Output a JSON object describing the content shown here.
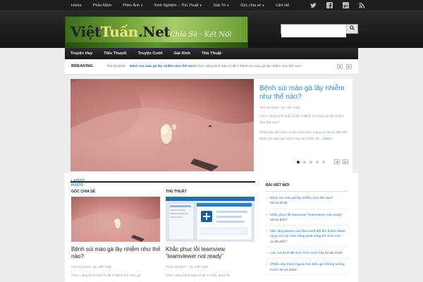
{
  "topnav": {
    "items": [
      "Home",
      "Phần Mềm",
      "Phim Ảnh",
      "Kinh Nghiệm – Thủ Thuật",
      "Giải Trí",
      "Góc chia sẻ",
      "Liên Hệ"
    ]
  },
  "header": {
    "logo_part1": "Việt",
    "logo_part2": "Tuấn",
    "logo_part3": ".Net",
    "tagline": "Chia Sẻ · Kết Nối",
    "search_placeholder": ""
  },
  "catnav": {
    "items": [
      "Truyện Hay",
      "Tiểu Thuyết",
      "Truyện Cười",
      "Gái Xinh",
      "Thủ Thuật"
    ]
  },
  "breaking": {
    "label": "BREAKING",
    "date": "Th4 03,2018",
    "link": "Bệnh sùi mào gà lây nhiễm như thế nào?",
    "excerpt": "Chức năng bình luận bị tắt ở Bệnh sùi mào gà lây nhiễm như thế nào?",
    "prev": "◂",
    "next": "▸"
  },
  "slider": {
    "title": "Bệnh sùi mào gà lây nhiễm như thế nào?",
    "meta": "Th4 03,2018 · by Viết Tuấn",
    "comments": "Chức năng bình luận bị tắt ở Bệnh sùi mào gà lây nhiễm như thế nào?",
    "excerpt": "Chào bác sĩ! Cháu có tìm hiểu trên mạng và được biết đến bệnh sùi mào gà một trong các bệnh xã...",
    "more": "more »",
    "prev": "◂",
    "next": "▸"
  },
  "latest": {
    "label1": "LATEST",
    "label2": "POSTS"
  },
  "posts": [
    {
      "category": "GÓC CHIA SẺ",
      "title": "Bệnh sùi mào gà lây nhiễm như thế nào?",
      "meta": "Th4 03,2018 · by Viết Tuấn",
      "excerpt": "Chức năng bình luận bị tắt ở Bệnh sùi mào gà"
    },
    {
      "category": "THỦ THUẬT",
      "title": "Khắc phục lỗi teamview “teamviewer not ready”",
      "meta": "Th12 25,2017 · by Viết Tuấn",
      "excerpt": "Chức năng bình luận bị tắt ở Khắc phục lỗi"
    }
  ],
  "sidebar": {
    "title": "BÀI VIẾT MỚI",
    "items": [
      {
        "text": "Bệnh sùi mào gà lây nhiễm như thế nào?",
        "date": "03.04.2018"
      },
      {
        "text": "Khắc phục lỗi teamview “teamviewer not ready”",
        "date": "25.12.2017"
      },
      {
        "text": "Nền tảng Beam của Microsoft đổi tên thành Mixer cùng với các tính năng phát sóng trò chơi mới",
        "date": "11.06.2017"
      },
      {
        "text": "Các mã lệnh để chơi GTA Vice City",
        "date": "03.05.2016"
      },
      {
        "text": "(Phần tiếp theo) Ngoại tình bất ngờ không lường trước",
        "date": "28.10.2015"
      }
    ]
  },
  "colors": {
    "accent": "#2a8ad9",
    "topbar": "#1e1e1e"
  }
}
